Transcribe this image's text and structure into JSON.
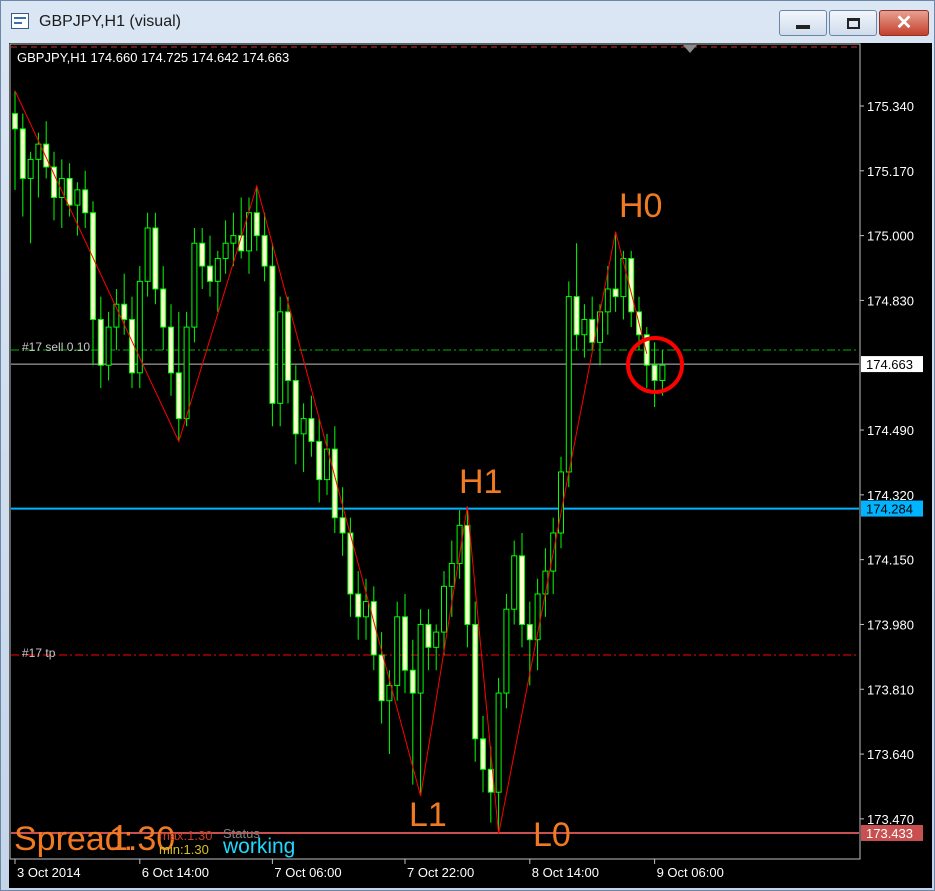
{
  "window": {
    "title": "GBPJPY,H1 (visual)",
    "app_icon": "chart-window-icon",
    "controls": {
      "minimize": "minimize-icon",
      "maximize": "maximize-icon",
      "close": "close-icon"
    }
  },
  "chart_header": {
    "text": "GBPJPY,H1  174.660 174.725 174.642 174.663"
  },
  "colors": {
    "background": "#000000",
    "candle_outline": "#00ff00",
    "candle_bull_body": "#000000",
    "candle_bear_body": "#ffffd0",
    "zigzag": "#ff0000",
    "zigzag_labels": "#f07a22",
    "order_line": "#00b400",
    "tp_line": "#ff0000",
    "level_blue": "#00b4ff",
    "level_red": "#c85050",
    "bid_line": "#c0c0c0",
    "circle": "#ff0000"
  },
  "price_axis": {
    "ticks": [
      "175.340",
      "175.170",
      "175.000",
      "174.830",
      "174.663",
      "174.490",
      "174.320",
      "174.284",
      "174.150",
      "173.980",
      "173.810",
      "173.640",
      "173.470",
      "173.433"
    ],
    "current_price": "174.663",
    "blue_level_label": "174.284",
    "red_level_label": "173.433"
  },
  "time_axis": {
    "ticks": [
      "3 Oct 2014",
      "6 Oct 14:00",
      "7 Oct 06:00",
      "7 Oct 22:00",
      "8 Oct 14:00",
      "9 Oct 06:00"
    ]
  },
  "lines": {
    "order_label": "#17 sell 0.10",
    "tp_label": "#17 tp"
  },
  "zigzag_labels": [
    "H0",
    "H1",
    "L1",
    "L0"
  ],
  "overlay": {
    "spread_text": "Spread:",
    "spread_value": "1.30",
    "max_text": "max:1.30",
    "min_text": "min:1.30",
    "status_label": "Status",
    "status_value": "working"
  },
  "chart_data": {
    "type": "candlestick",
    "symbol": "GBPJPY",
    "timeframe": "H1",
    "ylim": [
      173.37,
      175.5
    ],
    "levels": {
      "order_open": 174.7,
      "take_profit": 173.9,
      "blue_level": 174.284,
      "red_level": 173.433,
      "bid": 174.663
    },
    "zigzag": {
      "points": [
        {
          "i": 0,
          "price": 175.38
        },
        {
          "i": 21,
          "price": 174.46
        },
        {
          "i": 31,
          "price": 175.13
        },
        {
          "i": 52,
          "price": 173.53
        },
        {
          "i": 58,
          "price": 174.29
        },
        {
          "i": 62,
          "price": 173.43
        },
        {
          "i": 77,
          "price": 175.01
        },
        {
          "i": 81,
          "price": 174.69
        }
      ]
    },
    "candles": [
      {
        "o": 175.32,
        "h": 175.38,
        "l": 175.12,
        "c": 175.28
      },
      {
        "o": 175.28,
        "h": 175.32,
        "l": 175.05,
        "c": 175.15
      },
      {
        "o": 175.15,
        "h": 175.22,
        "l": 174.98,
        "c": 175.2
      },
      {
        "o": 175.2,
        "h": 175.27,
        "l": 175.1,
        "c": 175.24
      },
      {
        "o": 175.24,
        "h": 175.3,
        "l": 175.15,
        "c": 175.18
      },
      {
        "o": 175.18,
        "h": 175.22,
        "l": 175.04,
        "c": 175.1
      },
      {
        "o": 175.1,
        "h": 175.2,
        "l": 175.02,
        "c": 175.15
      },
      {
        "o": 175.15,
        "h": 175.19,
        "l": 175.05,
        "c": 175.08
      },
      {
        "o": 175.08,
        "h": 175.14,
        "l": 175.0,
        "c": 175.12
      },
      {
        "o": 175.12,
        "h": 175.17,
        "l": 175.02,
        "c": 175.06
      },
      {
        "o": 175.06,
        "h": 175.09,
        "l": 174.66,
        "c": 174.78
      },
      {
        "o": 174.78,
        "h": 174.84,
        "l": 174.6,
        "c": 174.66
      },
      {
        "o": 174.66,
        "h": 174.8,
        "l": 174.62,
        "c": 174.76
      },
      {
        "o": 174.76,
        "h": 174.86,
        "l": 174.7,
        "c": 174.82
      },
      {
        "o": 174.82,
        "h": 174.9,
        "l": 174.74,
        "c": 174.78
      },
      {
        "o": 174.78,
        "h": 174.84,
        "l": 174.6,
        "c": 174.64
      },
      {
        "o": 174.64,
        "h": 174.92,
        "l": 174.6,
        "c": 174.88
      },
      {
        "o": 174.88,
        "h": 175.06,
        "l": 174.84,
        "c": 175.02
      },
      {
        "o": 175.02,
        "h": 175.06,
        "l": 174.82,
        "c": 174.86
      },
      {
        "o": 174.86,
        "h": 174.92,
        "l": 174.7,
        "c": 174.76
      },
      {
        "o": 174.76,
        "h": 174.82,
        "l": 174.58,
        "c": 174.64
      },
      {
        "o": 174.64,
        "h": 174.8,
        "l": 174.46,
        "c": 174.52
      },
      {
        "o": 174.52,
        "h": 174.8,
        "l": 174.5,
        "c": 174.76
      },
      {
        "o": 174.76,
        "h": 175.02,
        "l": 174.72,
        "c": 174.98
      },
      {
        "o": 174.98,
        "h": 175.02,
        "l": 174.86,
        "c": 174.92
      },
      {
        "o": 174.92,
        "h": 175.0,
        "l": 174.84,
        "c": 174.88
      },
      {
        "o": 174.88,
        "h": 174.96,
        "l": 174.8,
        "c": 174.94
      },
      {
        "o": 174.94,
        "h": 175.04,
        "l": 174.9,
        "c": 174.98
      },
      {
        "o": 174.98,
        "h": 175.06,
        "l": 174.92,
        "c": 175.0
      },
      {
        "o": 175.0,
        "h": 175.1,
        "l": 174.94,
        "c": 174.96
      },
      {
        "o": 174.96,
        "h": 175.1,
        "l": 174.9,
        "c": 175.06
      },
      {
        "o": 175.06,
        "h": 175.13,
        "l": 174.96,
        "c": 175.0
      },
      {
        "o": 175.0,
        "h": 175.06,
        "l": 174.88,
        "c": 174.92
      },
      {
        "o": 174.92,
        "h": 174.98,
        "l": 174.5,
        "c": 174.56
      },
      {
        "o": 174.56,
        "h": 174.84,
        "l": 174.5,
        "c": 174.8
      },
      {
        "o": 174.8,
        "h": 174.84,
        "l": 174.56,
        "c": 174.62
      },
      {
        "o": 174.62,
        "h": 174.66,
        "l": 174.4,
        "c": 174.48
      },
      {
        "o": 174.48,
        "h": 174.56,
        "l": 174.38,
        "c": 174.52
      },
      {
        "o": 174.52,
        "h": 174.58,
        "l": 174.42,
        "c": 174.46
      },
      {
        "o": 174.46,
        "h": 174.52,
        "l": 174.3,
        "c": 174.36
      },
      {
        "o": 174.36,
        "h": 174.48,
        "l": 174.32,
        "c": 174.44
      },
      {
        "o": 174.44,
        "h": 174.5,
        "l": 174.22,
        "c": 174.26
      },
      {
        "o": 174.26,
        "h": 174.34,
        "l": 174.16,
        "c": 174.22
      },
      {
        "o": 174.22,
        "h": 174.26,
        "l": 174.0,
        "c": 174.06
      },
      {
        "o": 174.06,
        "h": 174.12,
        "l": 173.94,
        "c": 174.0
      },
      {
        "o": 174.0,
        "h": 174.1,
        "l": 173.94,
        "c": 174.04
      },
      {
        "o": 174.04,
        "h": 174.08,
        "l": 173.86,
        "c": 173.9
      },
      {
        "o": 173.9,
        "h": 173.96,
        "l": 173.72,
        "c": 173.78
      },
      {
        "o": 173.78,
        "h": 173.86,
        "l": 173.64,
        "c": 173.82
      },
      {
        "o": 173.82,
        "h": 174.04,
        "l": 173.78,
        "c": 174.0
      },
      {
        "o": 174.0,
        "h": 174.06,
        "l": 173.8,
        "c": 173.86
      },
      {
        "o": 173.86,
        "h": 173.94,
        "l": 173.56,
        "c": 173.8
      },
      {
        "o": 173.8,
        "h": 174.02,
        "l": 173.53,
        "c": 173.98
      },
      {
        "o": 173.98,
        "h": 174.02,
        "l": 173.86,
        "c": 173.92
      },
      {
        "o": 173.92,
        "h": 173.98,
        "l": 173.86,
        "c": 173.96
      },
      {
        "o": 173.96,
        "h": 174.12,
        "l": 173.9,
        "c": 174.08
      },
      {
        "o": 174.08,
        "h": 174.2,
        "l": 174.0,
        "c": 174.14
      },
      {
        "o": 174.14,
        "h": 174.28,
        "l": 174.1,
        "c": 174.24
      },
      {
        "o": 174.24,
        "h": 174.29,
        "l": 173.92,
        "c": 173.98
      },
      {
        "o": 173.98,
        "h": 174.04,
        "l": 173.62,
        "c": 173.68
      },
      {
        "o": 173.68,
        "h": 173.74,
        "l": 173.54,
        "c": 173.6
      },
      {
        "o": 173.6,
        "h": 173.66,
        "l": 173.46,
        "c": 173.54
      },
      {
        "o": 173.54,
        "h": 173.84,
        "l": 173.43,
        "c": 173.8
      },
      {
        "o": 173.8,
        "h": 174.06,
        "l": 173.76,
        "c": 174.02
      },
      {
        "o": 174.02,
        "h": 174.2,
        "l": 173.98,
        "c": 174.16
      },
      {
        "o": 174.16,
        "h": 174.22,
        "l": 173.92,
        "c": 173.98
      },
      {
        "o": 173.98,
        "h": 174.04,
        "l": 173.82,
        "c": 173.94
      },
      {
        "o": 173.94,
        "h": 174.1,
        "l": 173.86,
        "c": 174.06
      },
      {
        "o": 174.06,
        "h": 174.18,
        "l": 174.0,
        "c": 174.12
      },
      {
        "o": 174.12,
        "h": 174.26,
        "l": 174.06,
        "c": 174.22
      },
      {
        "o": 174.22,
        "h": 174.42,
        "l": 174.18,
        "c": 174.38
      },
      {
        "o": 174.38,
        "h": 174.88,
        "l": 174.34,
        "c": 174.84
      },
      {
        "o": 174.84,
        "h": 174.98,
        "l": 174.7,
        "c": 174.74
      },
      {
        "o": 174.74,
        "h": 174.82,
        "l": 174.68,
        "c": 174.78
      },
      {
        "o": 174.78,
        "h": 174.84,
        "l": 174.7,
        "c": 174.72
      },
      {
        "o": 174.72,
        "h": 174.82,
        "l": 174.66,
        "c": 174.8
      },
      {
        "o": 174.8,
        "h": 174.92,
        "l": 174.74,
        "c": 174.86
      },
      {
        "o": 174.86,
        "h": 175.01,
        "l": 174.8,
        "c": 174.84
      },
      {
        "o": 174.84,
        "h": 174.96,
        "l": 174.78,
        "c": 174.94
      },
      {
        "o": 174.94,
        "h": 174.96,
        "l": 174.76,
        "c": 174.8
      },
      {
        "o": 174.8,
        "h": 174.84,
        "l": 174.7,
        "c": 174.74
      },
      {
        "o": 174.74,
        "h": 174.76,
        "l": 174.6,
        "c": 174.66
      },
      {
        "o": 174.66,
        "h": 174.72,
        "l": 174.55,
        "c": 174.62
      },
      {
        "o": 174.62,
        "h": 174.7,
        "l": 174.58,
        "c": 174.66
      }
    ]
  }
}
